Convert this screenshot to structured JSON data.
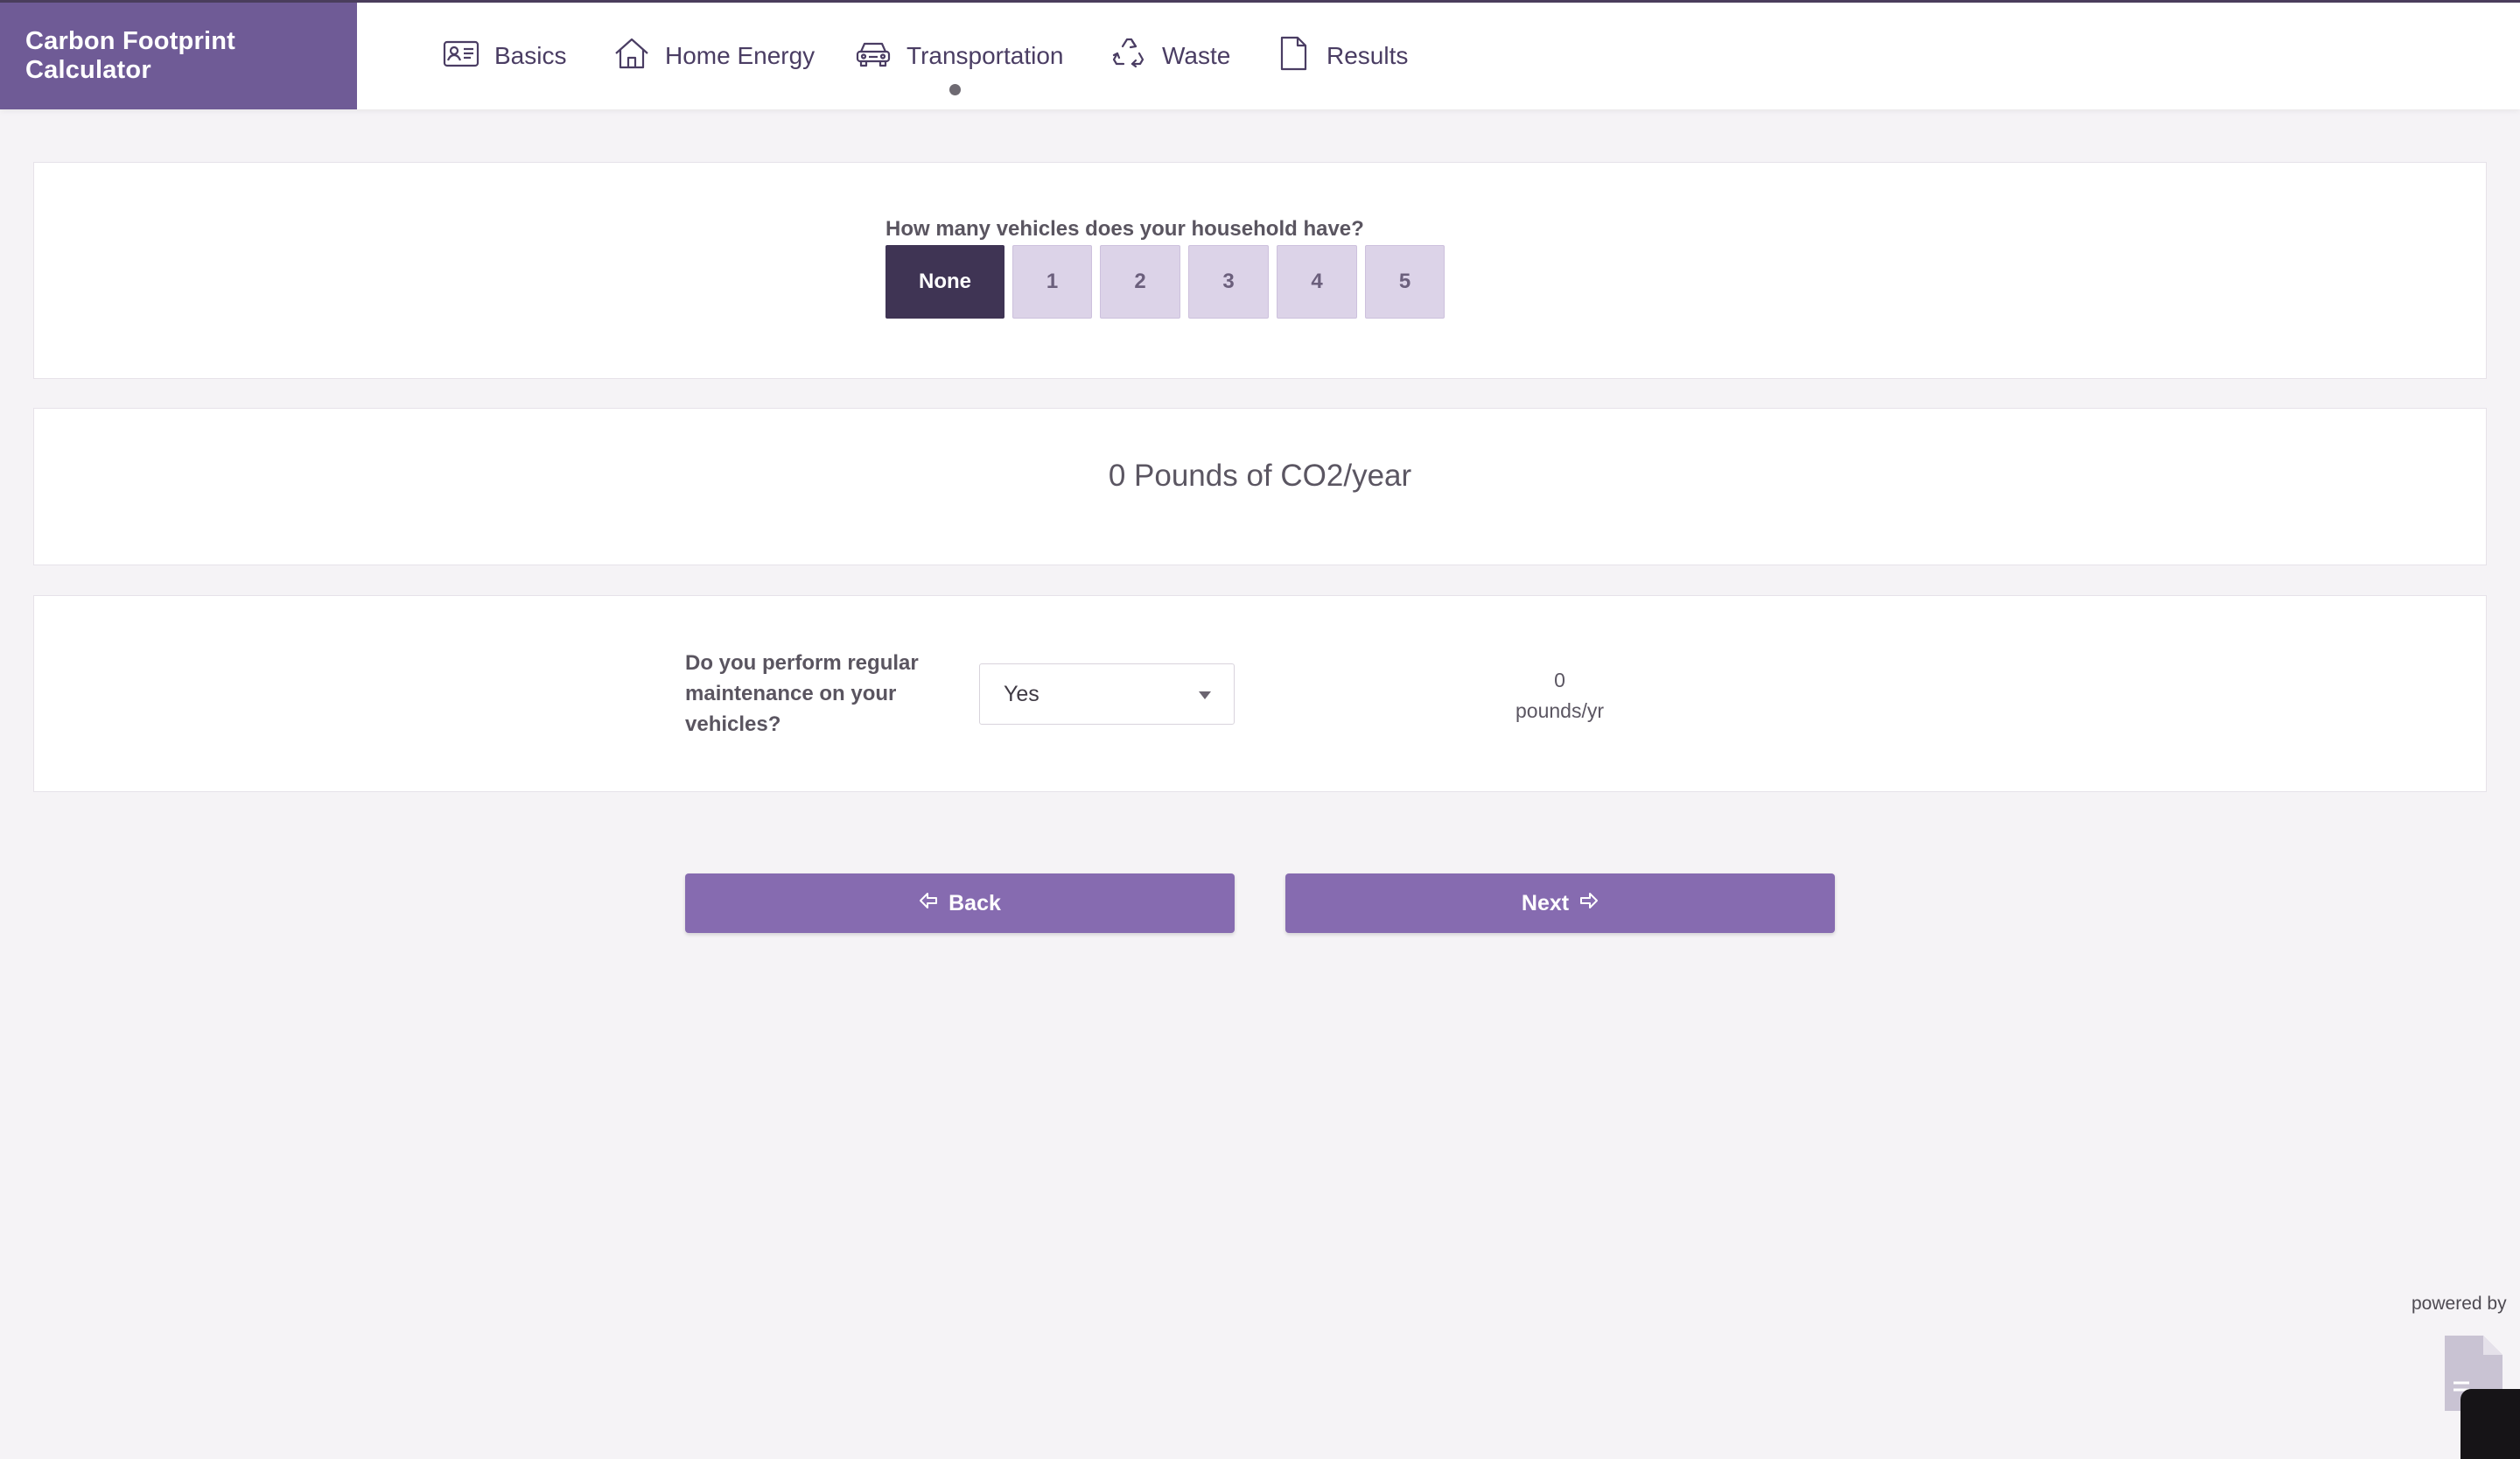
{
  "header": {
    "brand": "Carbon Footprint Calculator",
    "nav": [
      {
        "label": "Basics",
        "icon": "id-card-icon"
      },
      {
        "label": "Home Energy",
        "icon": "house-icon"
      },
      {
        "label": "Transportation",
        "icon": "car-icon",
        "active": true
      },
      {
        "label": "Waste",
        "icon": "recycle-icon"
      },
      {
        "label": "Results",
        "icon": "document-icon"
      }
    ]
  },
  "vehicles": {
    "question": "How many vehicles does your household have?",
    "options": [
      "None",
      "1",
      "2",
      "3",
      "4",
      "5"
    ],
    "selected": "None"
  },
  "total": {
    "text": "0 Pounds of CO2/year"
  },
  "maintenance": {
    "question": "Do you perform regular maintenance on your vehicles?",
    "selected": "Yes",
    "result_value": "0",
    "result_unit": "pounds/yr"
  },
  "buttons": {
    "back": "Back",
    "next": "Next"
  },
  "footer": {
    "powered_by": "powered by"
  },
  "colors": {
    "brand": "#6f5b96",
    "active_option": "#3f3454",
    "option": "#dcd3e8",
    "button": "#866bb0"
  }
}
